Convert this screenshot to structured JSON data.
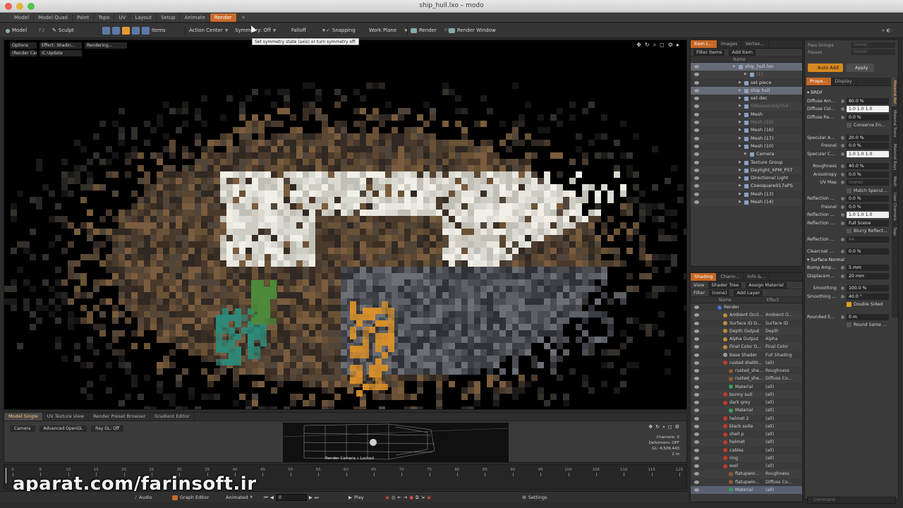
{
  "window": {
    "title": "ship_hull.lxo – modo"
  },
  "layout_tabs": [
    "Model",
    "Model Quad",
    "Paint",
    "Topo",
    "UV",
    "Layout",
    "Setup",
    "Animate",
    "Render"
  ],
  "layout_tabs_active": "Render",
  "toolbar": {
    "model": "Model",
    "model_key": "F2",
    "sculpt": "Sculpt",
    "items": "Items",
    "action_center": "Action Center",
    "symmetry": "Symmetry: Off",
    "falloff": "Falloff",
    "snapping": "Snapping",
    "work_plane": "Work Plane",
    "render": "Render",
    "render_key": "F9",
    "render_window": "Render Window"
  },
  "tooltip": "Set symmetry state (axis) or turn symmetry off.",
  "viewport": {
    "menu": [
      "Options",
      "Effect: Shadin...",
      "Rendering...",
      "(Render Camera)",
      "IC:Update"
    ]
  },
  "bottom_panel": {
    "tabs": [
      "Model Single",
      "UV Texture View",
      "Render Preset Browser",
      "Gradient Editor"
    ],
    "active_tab": "Model Single",
    "submenu": [
      "Camera",
      "Advanced OpenGL",
      "Ray GL: Off"
    ],
    "preview_label": "Render Camera • Locked",
    "channels": [
      "Channels: 0",
      "Deformers: OFF",
      "GL: 4,509,443",
      "2 m"
    ]
  },
  "timeline": {
    "ticks": [
      0,
      5,
      10,
      15,
      20,
      25,
      30,
      35,
      40,
      45,
      50,
      55,
      60,
      65,
      70,
      75,
      80,
      85,
      90,
      95,
      100,
      105,
      110,
      115,
      120
    ],
    "max": 120
  },
  "transport": {
    "audio": "Audio",
    "graph_editor": "Graph Editor",
    "animated": "Animated",
    "frame": "0",
    "play": "Play",
    "settings": "Settings"
  },
  "watermark": "aparat.com/farinsoft.ir",
  "item_list": {
    "tabs": [
      "Item L...",
      "Images",
      "Vertex..."
    ],
    "filter": "Filter Items",
    "add": "Add Item",
    "col_name": "Name",
    "rows": [
      {
        "label": "ship_hull.lxo",
        "indent": 0,
        "sel": true,
        "dim": false
      },
      {
        "label": "(1)",
        "indent": 2,
        "sel": false,
        "dim": true
      },
      {
        "label": "set piece",
        "indent": 1,
        "sel": false,
        "dim": false
      },
      {
        "label": "ship hull",
        "indent": 1,
        "sel": true,
        "dim": false
      },
      {
        "label": "set dec",
        "indent": 1,
        "sel": false,
        "dim": false
      },
      {
        "label": "SWassembly054",
        "indent": 1,
        "sel": false,
        "dim": true
      },
      {
        "label": "Mesh",
        "indent": 1,
        "sel": false,
        "dim": false
      },
      {
        "label": "Mesh (15)",
        "indent": 1,
        "sel": false,
        "dim": true
      },
      {
        "label": "Mesh (16)",
        "indent": 1,
        "sel": false,
        "dim": false
      },
      {
        "label": "Mesh (17)",
        "indent": 1,
        "sel": false,
        "dim": false
      },
      {
        "label": "Mesh (10)",
        "indent": 1,
        "sel": false,
        "dim": false
      },
      {
        "label": "Camera",
        "indent": 2,
        "sel": false,
        "dim": false
      },
      {
        "label": "Texture Group",
        "indent": 1,
        "sel": false,
        "dim": false
      },
      {
        "label": "Daylight_6PM_PST",
        "indent": 1,
        "sel": false,
        "dim": false
      },
      {
        "label": "Directional Light",
        "indent": 1,
        "sel": false,
        "dim": false
      },
      {
        "label": "Cswsquare017aPS",
        "indent": 1,
        "sel": false,
        "dim": false
      },
      {
        "label": "Mesh (13)",
        "indent": 1,
        "sel": false,
        "dim": false
      },
      {
        "label": "Mesh (14)",
        "indent": 1,
        "sel": false,
        "dim": false
      }
    ]
  },
  "shading": {
    "tabs": [
      "Shading",
      "Chann...",
      "Info &..."
    ],
    "view_label": "View",
    "view_value": "Shader Tree",
    "assign": "Assign Material",
    "filter_label": "Filter",
    "filter_value": "(none)",
    "add_layer": "Add Layer",
    "col_name": "Name",
    "col_effect": "Effect",
    "rows": [
      {
        "name": "Render",
        "effect": "",
        "color": "#4a70c8",
        "indent": 0
      },
      {
        "name": "Ambient Occl...",
        "effect": "Ambient O...",
        "color": "#c28b36",
        "indent": 1
      },
      {
        "name": "Surface ID O...",
        "effect": "Surface ID",
        "color": "#c28b36",
        "indent": 1
      },
      {
        "name": "Depth Output",
        "effect": "Depth",
        "color": "#c28b36",
        "indent": 1
      },
      {
        "name": "Alpha Output",
        "effect": "Alpha",
        "color": "#c28b36",
        "indent": 1
      },
      {
        "name": "Final Color O...",
        "effect": "Final Color",
        "color": "#c28b36",
        "indent": 1
      },
      {
        "name": "Base Shader",
        "effect": "Full Shading",
        "color": "#9a9a9a",
        "indent": 1
      },
      {
        "name": "rusted shell0...",
        "effect": "(all)",
        "color": "#c0392b",
        "indent": 1
      },
      {
        "name": "rusted_she...",
        "effect": "Roughness",
        "color": "#8a5a3a",
        "indent": 2
      },
      {
        "name": "rusted_she...",
        "effect": "Diffuse Co...",
        "color": "#8a5a3a",
        "indent": 2
      },
      {
        "name": "Material",
        "effect": "(all)",
        "color": "#3a9a5a",
        "indent": 2
      },
      {
        "name": "bunny suit",
        "effect": "(all)",
        "color": "#c0392b",
        "indent": 1
      },
      {
        "name": "dark grey",
        "effect": "(all)",
        "color": "#c0392b",
        "indent": 1
      },
      {
        "name": "Material",
        "effect": "(all)",
        "color": "#3a9a5a",
        "indent": 2
      },
      {
        "name": "helmet 2",
        "effect": "(all)",
        "color": "#c0392b",
        "indent": 1
      },
      {
        "name": "black suite",
        "effect": "(all)",
        "color": "#c0392b",
        "indent": 1
      },
      {
        "name": "shell p",
        "effect": "(all)",
        "color": "#c0392b",
        "indent": 1
      },
      {
        "name": "helmet",
        "effect": "(all)",
        "color": "#c0392b",
        "indent": 1
      },
      {
        "name": "cables",
        "effect": "(all)",
        "color": "#c0392b",
        "indent": 1
      },
      {
        "name": "ring",
        "effect": "(all)",
        "color": "#c0392b",
        "indent": 1
      },
      {
        "name": "wall",
        "effect": "(all)",
        "color": "#c0392b",
        "indent": 1
      },
      {
        "name": "flatupwin...",
        "effect": "Roughness",
        "color": "#8a5a3a",
        "indent": 2
      },
      {
        "name": "flatupwin...",
        "effect": "Diffuse Co...",
        "color": "#8a5a3a",
        "indent": 2
      },
      {
        "name": "Material",
        "effect": "(all)",
        "color": "#3a9a5a",
        "indent": 2
      }
    ]
  },
  "properties": {
    "pass_groups": "Pass Groups",
    "pass_groups_val": "(none)",
    "passes": "Passes",
    "passes_val": "(none)",
    "auto_add": "Auto Add",
    "apply": "Apply",
    "tabs": [
      "Prope...",
      "Display"
    ],
    "section_brdf": "BRDF",
    "diffuse_amount_label": "Diffuse Am...",
    "diffuse_amount": "80.0 %",
    "diffuse_color_label": "Diffuse Col...",
    "diffuse_color": "1.0  1.0  1.0",
    "diffuse_rough_label": "Diffuse Ro...",
    "diffuse_rough": "0.0 %",
    "conserve": "Conserve En...",
    "specular_amount_label": "Specular A...",
    "specular_amount": "20.0 %",
    "fresnel_label": "Fresnel",
    "fresnel": "0.0 %",
    "specular_color_label": "Specular C...",
    "specular_color": "1.0  1.0  1.0",
    "roughness_label": "Roughness",
    "roughness": "40.0 %",
    "anisotropy_label": "Anisotropy",
    "anisotropy": "0.0 %",
    "uv_map_label": "UV Map",
    "uv_map": "(none)",
    "match_specular": "Match Specul...",
    "reflection_amount_label": "Reflection ...",
    "reflection_amount": "0.0 %",
    "fresnel2_label": "Fresnel",
    "fresnel2": "0.0 %",
    "reflection_color_label": "Reflection ...",
    "reflection_color": "1.0  1.0  1.0",
    "reflection_type_label": "Reflection ...",
    "reflection_type": "Full Scene",
    "blurry": "Blurry Reflect...",
    "reflection_rays_label": "Reflection ...",
    "reflection_rays": "64",
    "clearcoat_label": "Clearcoat ...",
    "clearcoat": "0.0 %",
    "surface_normal": "Surface Normal",
    "bump_label": "Bump Amp...",
    "bump": "5 mm",
    "displace_label": "Displacem...",
    "displace": "20 mm",
    "smoothing_label": "Smoothing",
    "smoothing": "100.0 %",
    "smoothing2_label": "Smoothing ...",
    "smoothing2": "40.0 °",
    "double_sided": "Double Sided",
    "rounded_label": "Rounded E...",
    "rounded": "0 m",
    "round_same": "Round Same ...",
    "vtabs": [
      "Material Ref",
      "Material Trans",
      "Material Rays",
      "Mesh",
      "User Channels",
      "Tags"
    ],
    "command": "Command"
  }
}
